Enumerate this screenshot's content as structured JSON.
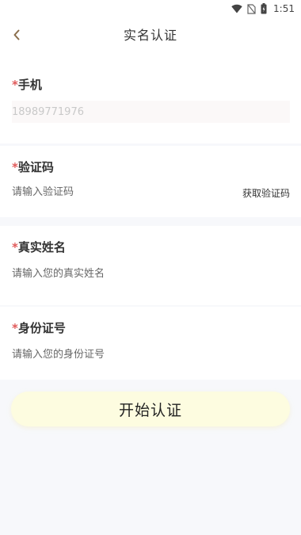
{
  "status_bar": {
    "time": "1:51",
    "icons": [
      "wifi-icon",
      "no-sim-icon",
      "battery-icon"
    ]
  },
  "header": {
    "title": "实名认证",
    "back_icon": "chevron-left-icon",
    "back_color": "#8a6d4b"
  },
  "form": {
    "required_mark": "*",
    "required_color": "#e05a5a",
    "phone": {
      "label": "手机",
      "value": "18989771976"
    },
    "code": {
      "label": "验证码",
      "placeholder": "请输入验证码",
      "get_code_label": "获取验证码"
    },
    "name": {
      "label": "真实姓名",
      "placeholder": "请输入您的真实姓名"
    },
    "id_number": {
      "label": "身份证号",
      "placeholder": "请输入您的身份证号"
    }
  },
  "actions": {
    "start_label": "开始认证",
    "start_color": "#fdfce0"
  }
}
